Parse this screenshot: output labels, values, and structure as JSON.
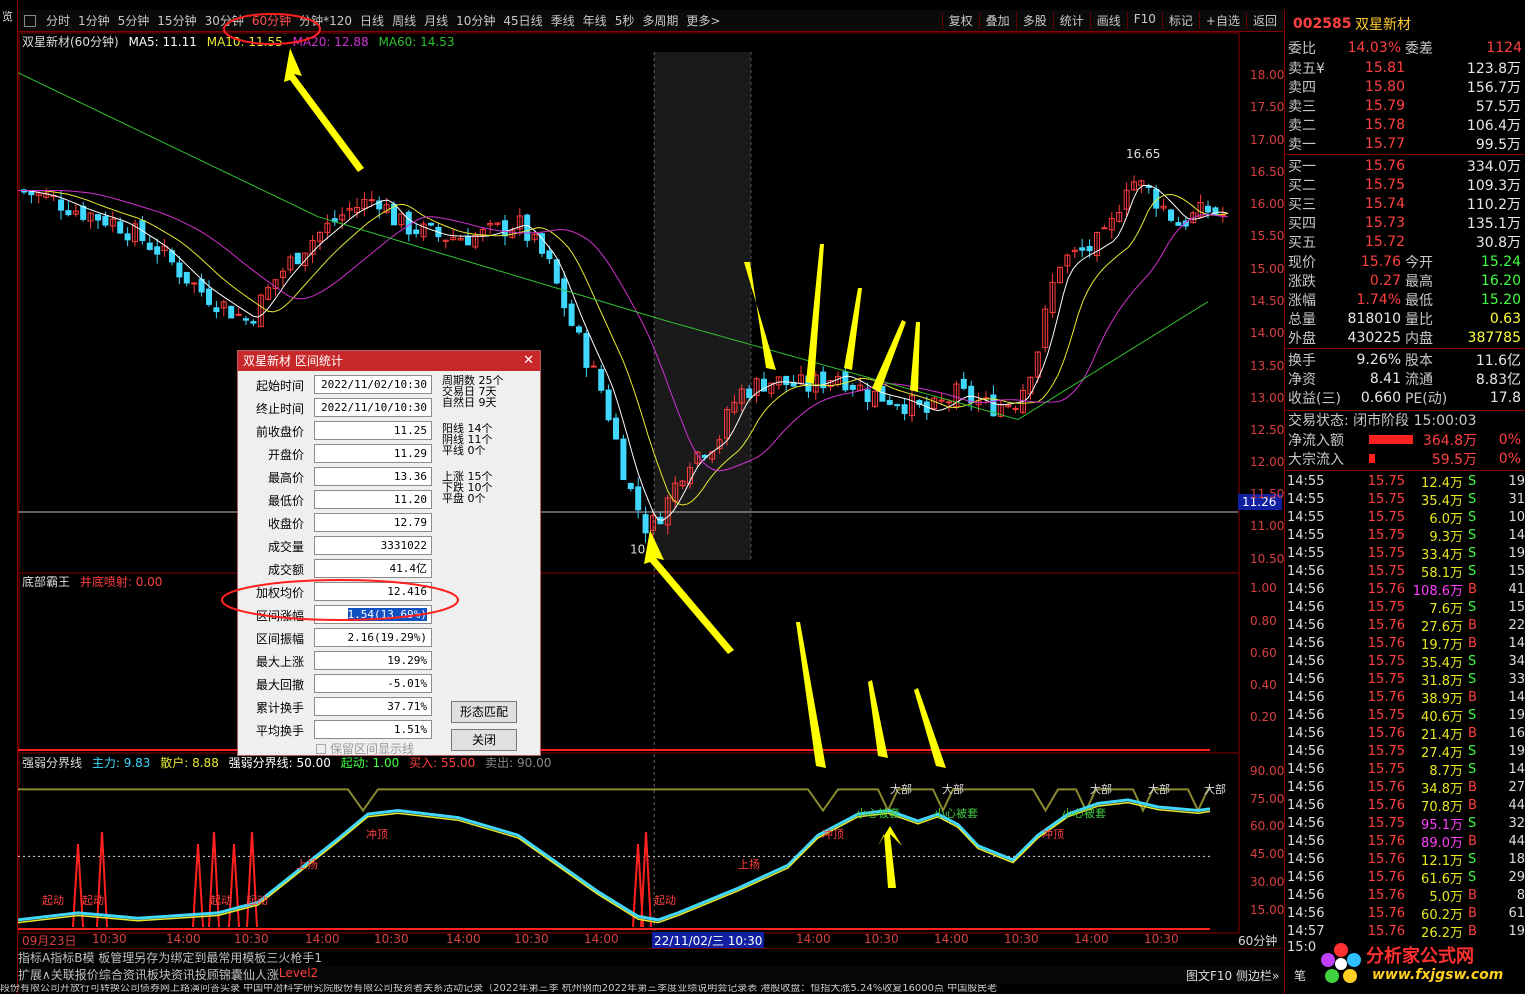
{
  "toolbar": {
    "periods": [
      "分时",
      "1分钟",
      "5分钟",
      "15分钟",
      "30分钟",
      "60分钟",
      "分钟*120",
      "日线",
      "周线",
      "月线",
      "10分钟",
      "45日线",
      "季线",
      "年线",
      "5秒",
      "多周期",
      "更多>"
    ],
    "selected": "60分钟",
    "actions": [
      "复权",
      "叠加",
      "多股",
      "统计",
      "画线",
      "F10",
      "标记",
      "+自选",
      "返回"
    ]
  },
  "left_tabs": "览",
  "main_chart": {
    "title": "双星新材(60分钟)",
    "ma5": "MA5: 11.11",
    "ma10": "MA10: 11.55",
    "ma20": "MA20: 12.88",
    "ma60": "MA60: 14.53",
    "y_ticks": [
      "18.00",
      "17.50",
      "17.00",
      "16.50",
      "16.00",
      "15.50",
      "15.00",
      "14.50",
      "14.00",
      "13.50",
      "13.00",
      "12.50",
      "12.00",
      "11.50",
      "11.00",
      "10.50"
    ],
    "current_tag": "11.26",
    "high_label": "16.65",
    "low_label": "10.",
    "ylim": [
      10.3,
      18.4
    ],
    "colors": {
      "up": "#ff3c3c",
      "down": "#40d8ff",
      "ma5": "#ffffff",
      "ma10": "#e8e830",
      "ma20": "#d030d0",
      "ma60": "#30c030"
    },
    "highlight": {
      "start": 0.52,
      "end": 0.6
    }
  },
  "indicator1": {
    "title": "底部霸王",
    "sub_label": "井底喷射: 0.00",
    "y_ticks": [
      "1.00",
      "0.80",
      "0.60",
      "0.40",
      "0.20"
    ]
  },
  "indicator2": {
    "title": "强弱分界线",
    "s1": "主力: 9.83",
    "s2": "散户: 8.88",
    "s3": "强弱分界线: 50.00",
    "s4": "起动: 1.00",
    "s5": "买入: 55.00",
    "s6": "卖出: 90.00",
    "y_ticks": [
      "90.00",
      "75.00",
      "60.00",
      "45.00",
      "30.00",
      "15.00"
    ],
    "labels": {
      "qidong": "起动",
      "shangyang": "上扬",
      "chongding": "冲顶",
      "xiaoxin": "小心被套",
      "dabu": "大部"
    }
  },
  "time_axis": {
    "labels": [
      "09月23日",
      "10:30",
      "14:00",
      "10:30",
      "14:00",
      "10:30",
      "14:00",
      "10:30",
      "14:00",
      "22/11/02/三 10:30",
      "14:00",
      "10:30",
      "14:00",
      "10:30",
      "14:00",
      "10:30",
      "14:00"
    ],
    "period": "60分钟"
  },
  "bottom_tabs": [
    "指标A",
    "指标B",
    "模 板",
    "管理",
    "另存为",
    "绑定到",
    "最常用模板",
    "三火枪手1"
  ],
  "ext_tabs": [
    "扩展∧",
    "关联报价",
    "综合资讯",
    "板块资讯",
    "投顾锦囊",
    "仙人涨",
    "Level2"
  ],
  "ext_right": "图文F10  侧边栏»",
  "ext_right2": "笔",
  "ticker": "段份有限公司开放行可转换公司债券网上路演问答实录    中国中冶科学研究院股份有限公司投资者关系活动记录（2022年第三季    杭州钢而2022年第三季度业绩说明会记录表    港股收盘：恒指大涨5.24%收复16000点    中国股民老",
  "quote": {
    "code": "002585",
    "name": "双星新材",
    "webi": "委比",
    "webi_v": "14.03%",
    "wecha": "委差",
    "wecha_v": "1124",
    "sells": [
      [
        "卖五¥",
        "15.81",
        "123.8万"
      ],
      [
        "卖四",
        "15.80",
        "156.7万"
      ],
      [
        "卖三",
        "15.79",
        "57.5万"
      ],
      [
        "卖二",
        "15.78",
        "106.4万"
      ],
      [
        "卖一",
        "15.77",
        "99.5万"
      ]
    ],
    "buys": [
      [
        "买一",
        "15.76",
        "334.0万"
      ],
      [
        "买二",
        "15.75",
        "109.3万"
      ],
      [
        "买三",
        "15.74",
        "110.2万"
      ],
      [
        "买四",
        "15.73",
        "135.1万"
      ],
      [
        "买五",
        "15.72",
        "30.8万"
      ]
    ],
    "stats": [
      [
        "现价",
        "15.76",
        "今开",
        "15.24"
      ],
      [
        "涨跌",
        "0.27",
        "最高",
        "16.20"
      ],
      [
        "涨幅",
        "1.74%",
        "最低",
        "15.20"
      ],
      [
        "总量",
        "818010",
        "量比",
        "0.63"
      ],
      [
        "外盘",
        "430225",
        "内盘",
        "387785"
      ],
      [
        "换手",
        "9.26%",
        "股本",
        "11.6亿"
      ],
      [
        "净资",
        "8.41",
        "流通",
        "8.83亿"
      ],
      [
        "收益(三)",
        "0.660",
        "PE(动)",
        "17.8"
      ]
    ],
    "state": "交易状态: 闭市阶段 15:00:03",
    "flow": [
      [
        "净流入额",
        "364.8万",
        "0%"
      ],
      [
        "大宗流入",
        "59.5万",
        "0%"
      ]
    ],
    "trades": [
      [
        "14:55",
        "15.75",
        "12.4万",
        "S",
        "19"
      ],
      [
        "14:55",
        "15.75",
        "35.4万",
        "S",
        "31"
      ],
      [
        "14:55",
        "15.75",
        "6.0万",
        "S",
        "10"
      ],
      [
        "14:55",
        "15.75",
        "9.3万",
        "S",
        "14"
      ],
      [
        "14:55",
        "15.75",
        "33.4万",
        "S",
        "19"
      ],
      [
        "14:56",
        "15.75",
        "58.1万",
        "S",
        "15"
      ],
      [
        "14:56",
        "15.76",
        "108.6万",
        "B",
        "41"
      ],
      [
        "14:56",
        "15.75",
        "7.6万",
        "S",
        "15"
      ],
      [
        "14:56",
        "15.76",
        "27.6万",
        "B",
        "22"
      ],
      [
        "14:56",
        "15.76",
        "19.7万",
        "B",
        "14"
      ],
      [
        "14:56",
        "15.75",
        "35.4万",
        "S",
        "34"
      ],
      [
        "14:56",
        "15.75",
        "31.8万",
        "S",
        "33"
      ],
      [
        "14:56",
        "15.76",
        "38.9万",
        "B",
        "14"
      ],
      [
        "14:56",
        "15.75",
        "40.6万",
        "S",
        "19"
      ],
      [
        "14:56",
        "15.76",
        "21.4万",
        "B",
        "16"
      ],
      [
        "14:56",
        "15.75",
        "27.4万",
        "S",
        "19"
      ],
      [
        "14:56",
        "15.75",
        "8.7万",
        "S",
        "14"
      ],
      [
        "14:56",
        "15.76",
        "34.8万",
        "B",
        "27"
      ],
      [
        "14:56",
        "15.76",
        "70.8万",
        "B",
        "44"
      ],
      [
        "14:56",
        "15.75",
        "95.1万",
        "S",
        "32"
      ],
      [
        "14:56",
        "15.76",
        "89.0万",
        "B",
        "44"
      ],
      [
        "14:56",
        "15.76",
        "12.1万",
        "S",
        "18"
      ],
      [
        "14:56",
        "15.76",
        "61.6万",
        "S",
        "29"
      ],
      [
        "14:56",
        "15.76",
        "5.0万",
        "B",
        "8"
      ],
      [
        "14:56",
        "15.76",
        "60.2万",
        "B",
        "61"
      ],
      [
        "14:57",
        "15.76",
        "26.2万",
        "B",
        "19"
      ]
    ],
    "last_time": "15:0"
  },
  "dialog": {
    "title": "双星新材 区间统计",
    "rows": [
      [
        "起始时间",
        "2022/11/02/10:30"
      ],
      [
        "终止时间",
        "2022/11/10/10:30"
      ],
      [
        "前收盘价",
        "11.25"
      ],
      [
        "开盘价",
        "11.29"
      ],
      [
        "最高价",
        "13.36"
      ],
      [
        "最低价",
        "11.20"
      ],
      [
        "收盘价",
        "12.79"
      ],
      [
        "成交量",
        "3331022"
      ],
      [
        "成交额",
        "41.4亿"
      ],
      [
        "加权均价",
        "12.416"
      ],
      [
        "区间涨幅",
        "1.54(13.69%)"
      ],
      [
        "区间振幅",
        "2.16(19.29%)"
      ],
      [
        "最大上涨",
        "19.29%"
      ],
      [
        "最大回撤",
        "-5.01%"
      ],
      [
        "累计换手",
        "37.71%"
      ],
      [
        "平均换手",
        "1.51%"
      ]
    ],
    "side": [
      [
        "周期数",
        "25个"
      ],
      [
        "交易日",
        "7天"
      ],
      [
        "自然日",
        "9天"
      ],
      [
        "阳线",
        "14个"
      ],
      [
        "阴线",
        "11个"
      ],
      [
        "平线",
        "0个"
      ],
      [
        "上涨",
        "15个"
      ],
      [
        "下跌",
        "10个"
      ],
      [
        "平盘",
        "0个"
      ]
    ],
    "btn_pattern": "形态匹配",
    "btn_close": "关闭",
    "checkbox": "保留区间显示线"
  },
  "logo": {
    "title": "分析家公式网",
    "url": "www.fxjgsw.com"
  }
}
